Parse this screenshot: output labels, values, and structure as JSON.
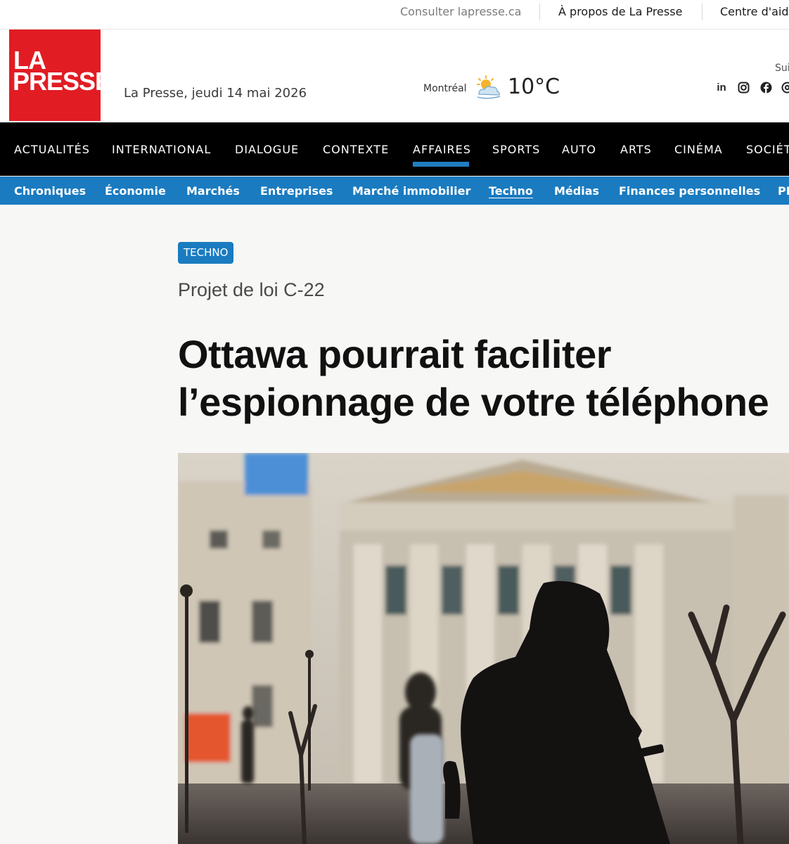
{
  "utility": {
    "links": [
      {
        "label": "Consulter lapresse.ca"
      },
      {
        "label": "À propos de La Presse"
      },
      {
        "label": "Centre d'aide"
      }
    ]
  },
  "masthead": {
    "logo_line1": "LA",
    "logo_line2": "PRESSE",
    "dateline": "La Presse, jeudi 14 mai 2026",
    "weather": {
      "city": "Montréal",
      "temperature": "10°C",
      "icon": "partly-sunny-icon"
    },
    "follow_label": "Suivez-nous",
    "social_icons": [
      "linkedin-icon",
      "instagram-icon",
      "facebook-icon",
      "threads-icon"
    ]
  },
  "nav": {
    "items": [
      {
        "label": "ACTUALITÉS"
      },
      {
        "label": "INTERNATIONAL"
      },
      {
        "label": "DIALOGUE"
      },
      {
        "label": "CONTEXTE"
      },
      {
        "label": "AFFAIRES"
      },
      {
        "label": "SPORTS"
      },
      {
        "label": "AUTO"
      },
      {
        "label": "ARTS"
      },
      {
        "label": "CINÉMA"
      },
      {
        "label": "SOCIÉTÉ"
      }
    ],
    "active": "AFFAIRES",
    "accent_color": "#1f7fc2"
  },
  "subnav": {
    "items": [
      {
        "label": "Chroniques"
      },
      {
        "label": "Économie"
      },
      {
        "label": "Marchés"
      },
      {
        "label": "Entreprises"
      },
      {
        "label": "Marché immobilier"
      },
      {
        "label": "Techno"
      },
      {
        "label": "Médias"
      },
      {
        "label": "Finances personnelles"
      },
      {
        "label": "PME"
      }
    ],
    "active": "Techno",
    "background_color": "#1a7bc0"
  },
  "article": {
    "section_badge": "TECHNO",
    "kicker": "Projet de loi C-22",
    "headline_line1": "Ottawa pourrait faciliter",
    "headline_line2": "l’espionnage de votre téléphone"
  },
  "colors": {
    "brand_red": "#e21c23",
    "nav_black": "#000000",
    "page_background": "#f7f7f5"
  }
}
